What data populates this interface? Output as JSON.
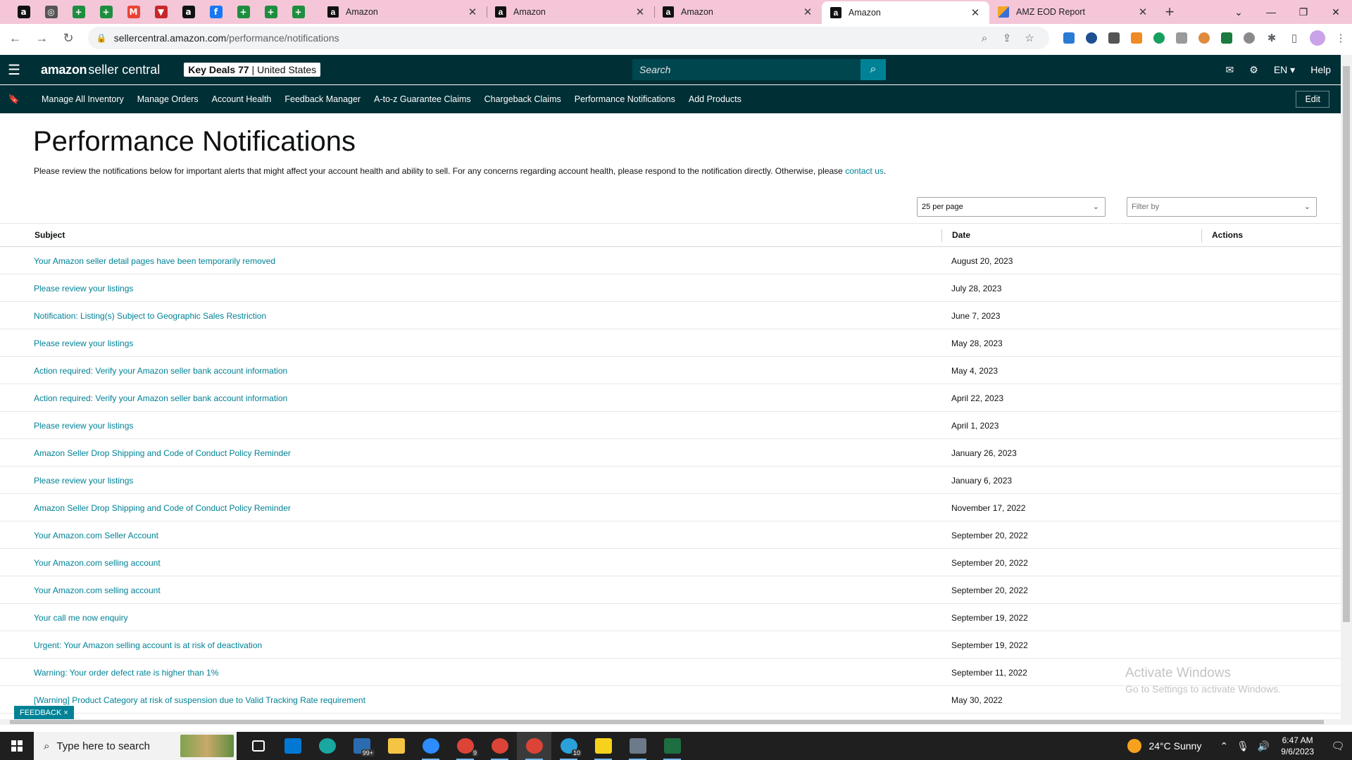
{
  "browser": {
    "pinned_tabs": [
      {
        "icon": "amazon-icon",
        "glyph": "a",
        "color": "#111111"
      },
      {
        "icon": "chrome-icon",
        "glyph": "◎",
        "color": "#555555"
      },
      {
        "icon": "sheets-icon",
        "glyph": "+",
        "color": "#1e8e3e"
      },
      {
        "icon": "sheets-icon",
        "glyph": "+",
        "color": "#1e8e3e"
      },
      {
        "icon": "gmail-icon",
        "glyph": "M",
        "color": "#ea4335"
      },
      {
        "icon": "todoist-icon",
        "glyph": "▼",
        "color": "#c62828"
      },
      {
        "icon": "amazon-icon",
        "glyph": "a",
        "color": "#111111"
      },
      {
        "icon": "facebook-icon",
        "glyph": "f",
        "color": "#1877f2"
      },
      {
        "icon": "sheets-icon",
        "glyph": "+",
        "color": "#1e8e3e"
      },
      {
        "icon": "sheets-icon",
        "glyph": "+",
        "color": "#1e8e3e"
      },
      {
        "icon": "sheets-icon",
        "glyph": "+",
        "color": "#1e8e3e"
      }
    ],
    "tabs": [
      {
        "title": "Amazon",
        "active": false
      },
      {
        "title": "Amazon",
        "active": false
      },
      {
        "title": "Amazon",
        "active": false
      },
      {
        "title": "Amazon",
        "active": true
      },
      {
        "title": "AMZ EOD Report",
        "active": false
      }
    ],
    "url_host": "sellercentral.amazon.com",
    "url_path": "/performance/notifications"
  },
  "seller_central": {
    "logo_brand": "amazon",
    "logo_product": "seller central",
    "store_name": "Key Deals 77",
    "store_region": "United States",
    "search_placeholder": "Search",
    "language": "EN",
    "help": "Help",
    "nav_links": [
      "Manage All Inventory",
      "Manage Orders",
      "Account Health",
      "Feedback Manager",
      "A-to-z Guarantee Claims",
      "Chargeback Claims",
      "Performance Notifications",
      "Add Products"
    ],
    "edit_label": "Edit"
  },
  "page": {
    "title": "Performance Notifications",
    "intro_text": "Please review the notifications below for important alerts that might affect your account health and ability to sell. For any concerns regarding account health, please respond to the notification directly. Otherwise, please ",
    "intro_link": "contact us",
    "intro_end": ".",
    "per_page": "25 per page",
    "filter_placeholder": "Filter by",
    "columns": {
      "subject": "Subject",
      "date": "Date",
      "actions": "Actions"
    },
    "notifications": [
      {
        "subject": "Your Amazon seller detail pages have been temporarily removed",
        "date": "August 20, 2023"
      },
      {
        "subject": "Please review your listings",
        "date": "July 28, 2023"
      },
      {
        "subject": "Notification: Listing(s) Subject to Geographic Sales Restriction",
        "date": "June 7, 2023"
      },
      {
        "subject": "Please review your listings",
        "date": "May 28, 2023"
      },
      {
        "subject": "Action required: Verify your Amazon seller bank account information",
        "date": "May 4, 2023"
      },
      {
        "subject": "Action required: Verify your Amazon seller bank account information",
        "date": "April 22, 2023"
      },
      {
        "subject": "Please review your listings",
        "date": "April 1, 2023"
      },
      {
        "subject": "Amazon Seller Drop Shipping and Code of Conduct Policy Reminder",
        "date": "January 26, 2023"
      },
      {
        "subject": "Please review your listings",
        "date": "January 6, 2023"
      },
      {
        "subject": "Amazon Seller Drop Shipping and Code of Conduct Policy Reminder",
        "date": "November 17, 2022"
      },
      {
        "subject": "Your Amazon.com Seller Account",
        "date": "September 20, 2022"
      },
      {
        "subject": "Your Amazon.com selling account",
        "date": "September 20, 2022"
      },
      {
        "subject": "Your Amazon.com selling account",
        "date": "September 20, 2022"
      },
      {
        "subject": "Your call me now enquiry",
        "date": "September 19, 2022"
      },
      {
        "subject": "Urgent: Your Amazon selling account is at risk of deactivation",
        "date": "September 19, 2022"
      },
      {
        "subject": "Warning: Your order defect rate is higher than 1%",
        "date": "September 11, 2022"
      },
      {
        "subject": "[Warning] Product Category at risk of suspension due to Valid Tracking Rate requirement",
        "date": "May 30, 2022"
      }
    ],
    "feedback_label": "FEEDBACK ×"
  },
  "watermark": {
    "line1": "Activate Windows",
    "line2": "Go to Settings to activate Windows."
  },
  "taskbar": {
    "search_placeholder": "Type here to search",
    "apps": [
      {
        "name": "task-view-icon",
        "color": "#1f1f1f"
      },
      {
        "name": "store-icon",
        "color": "#0078d4"
      },
      {
        "name": "edge-icon",
        "color": "#1aa7a0"
      },
      {
        "name": "mail-icon",
        "color": "#2b6cb0",
        "badge": "99+"
      },
      {
        "name": "file-explorer-icon",
        "color": "#f4c542"
      },
      {
        "name": "zoom-icon",
        "color": "#2d8cff"
      },
      {
        "name": "chrome-icon",
        "color": "#db4437",
        "badge": "9"
      },
      {
        "name": "chrome-icon",
        "color": "#db4437"
      },
      {
        "name": "chrome-icon",
        "color": "#db4437"
      },
      {
        "name": "telegram-icon",
        "color": "#2aa1da",
        "badge": "10"
      },
      {
        "name": "sticky-notes-icon",
        "color": "#f7d21c"
      },
      {
        "name": "calculator-icon",
        "color": "#6c7a89"
      },
      {
        "name": "excel-icon",
        "color": "#1d6f42"
      }
    ],
    "weather": "24°C  Sunny",
    "time": "6:47 AM",
    "date": "9/6/2023"
  }
}
